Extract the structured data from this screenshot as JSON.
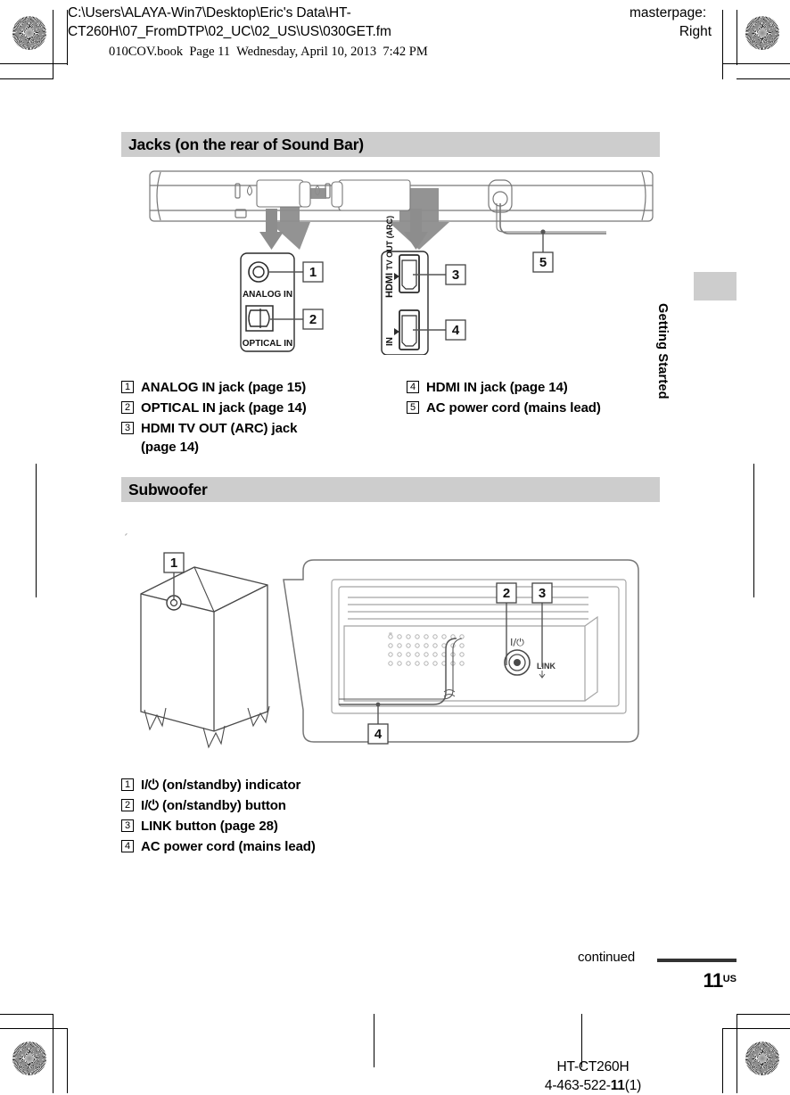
{
  "prepress": {
    "file_path_line1": "C:\\Users\\ALAYA-Win7\\Desktop\\Eric's Data\\HT-",
    "file_path_line2": "CT260H\\07_FromDTP\\02_UC\\02_US\\US\\030GET.fm",
    "masterpage_label": "masterpage:",
    "masterpage_value": "Right",
    "book_slug": "010COV.book  Page 11  Wednesday, April 10, 2013  7:42 PM"
  },
  "side_tab": {
    "label": "Getting Started"
  },
  "sections": [
    {
      "id": "jacks",
      "heading": "Jacks (on the rear of Sound Bar)",
      "figure": {
        "name": "sound-bar-rear-panel",
        "callouts": [
          "1",
          "2",
          "3",
          "4",
          "5"
        ],
        "panel_labels": [
          "ANALOG IN",
          "OPTICAL IN",
          "HDMI TV OUT (ARC)",
          "IN"
        ]
      },
      "legend_col_a": [
        {
          "num": "1",
          "text": "ANALOG IN jack (page 15)"
        },
        {
          "num": "2",
          "text": "OPTICAL IN jack (page 14)"
        },
        {
          "num": "3",
          "text": "HDMI TV OUT (ARC) jack",
          "text2": "(page 14)"
        }
      ],
      "legend_col_b": [
        {
          "num": "4",
          "text": "HDMI IN jack (page 14)"
        },
        {
          "num": "5",
          "text": "AC power cord (mains lead)"
        }
      ]
    },
    {
      "id": "subwoofer",
      "heading": "Subwoofer",
      "figure": {
        "name": "subwoofer-unit-and-rear-detail",
        "callouts": [
          "1",
          "2",
          "3",
          "4"
        ],
        "panel_labels": [
          "I/①",
          "LINK"
        ]
      },
      "legend": [
        {
          "num": "1",
          "text_pre": "I/",
          "glyph": "⏻",
          "text": " (on/standby) indicator"
        },
        {
          "num": "2",
          "text_pre": "I/",
          "glyph": "⏻",
          "text": " (on/standby) button"
        },
        {
          "num": "3",
          "text_pre": "",
          "glyph": "",
          "text": "LINK button (page 28)"
        },
        {
          "num": "4",
          "text_pre": "",
          "glyph": "",
          "text": "AC power cord (mains lead)"
        }
      ]
    }
  ],
  "footer": {
    "continued": "continued",
    "page_number": "11",
    "page_suffix": "US",
    "model": "HT-CT260H",
    "part_number_prefix": "4-463-522-",
    "part_number_bold": "11",
    "part_number_suffix": "(1)"
  },
  "colors": {
    "section_header_bg": "#cdcdcd",
    "text": "#000000",
    "line_art": "#6f6f6f"
  }
}
